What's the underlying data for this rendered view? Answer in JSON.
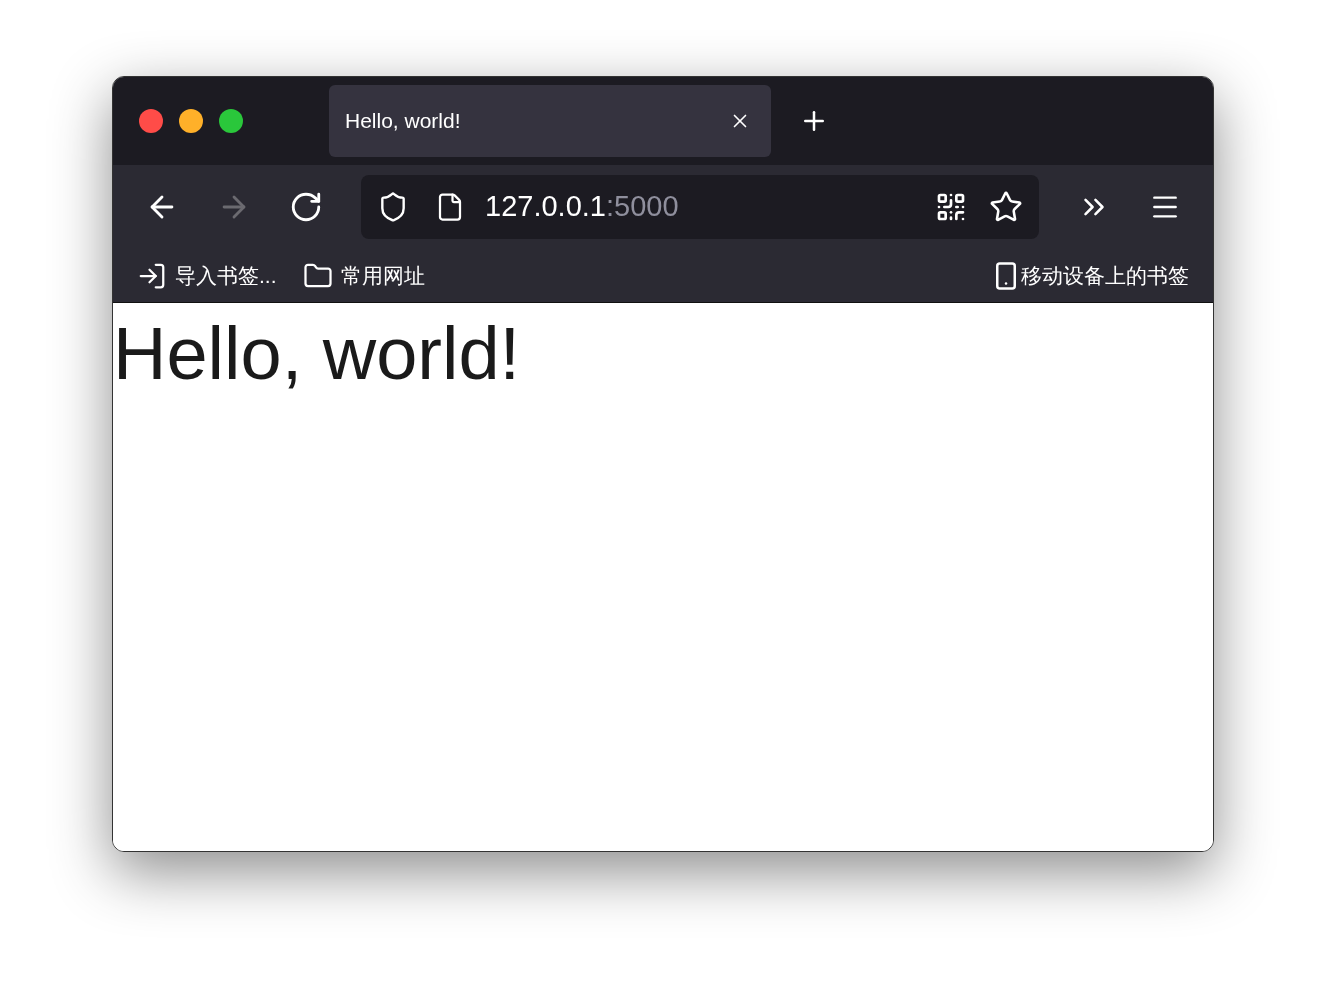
{
  "tabs": [
    {
      "title": "Hello, world!",
      "selected": true
    }
  ],
  "nav_buttons": [
    {
      "kind": "back",
      "disabled": false
    },
    {
      "kind": "forward",
      "disabled": true
    },
    {
      "kind": "reload",
      "disabled": false
    }
  ],
  "address": {
    "host": "127.0.0.1",
    "port": ":5000"
  },
  "bookmarks": [
    {
      "kind": "import",
      "label": "导入书签..."
    },
    {
      "kind": "folder",
      "label": "常用网址"
    }
  ],
  "mobile_bookmarks": "移动设备上的书签",
  "page": {
    "heading": "Hello, world!"
  }
}
